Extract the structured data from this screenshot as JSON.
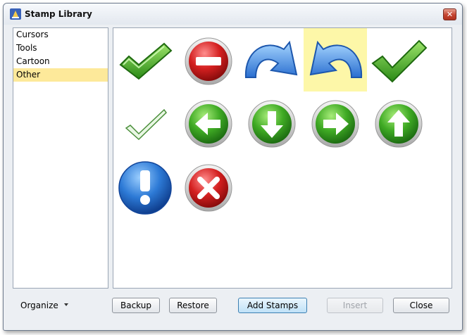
{
  "window": {
    "title": "Stamp Library"
  },
  "categories": [
    {
      "label": "Cursors",
      "selected": false
    },
    {
      "label": "Tools",
      "selected": false
    },
    {
      "label": "Cartoon",
      "selected": false
    },
    {
      "label": "Other",
      "selected": true
    }
  ],
  "stamps": [
    {
      "name": "green-check-3d-icon"
    },
    {
      "name": "red-minus-icon"
    },
    {
      "name": "blue-arrow-redo-icon"
    },
    {
      "name": "blue-arrow-undo-icon",
      "selected": true
    },
    {
      "name": "green-checkmark-icon"
    },
    {
      "name": "outline-checkmark-icon"
    },
    {
      "name": "green-arrow-left-icon"
    },
    {
      "name": "green-arrow-down-icon"
    },
    {
      "name": "green-arrow-right-icon"
    },
    {
      "name": "green-arrow-up-icon"
    },
    {
      "name": "blue-exclamation-icon"
    },
    {
      "name": "red-x-icon"
    }
  ],
  "footer": {
    "organize_label": "Organize",
    "backup_label": "Backup",
    "restore_label": "Restore",
    "add_stamps_label": "Add Stamps",
    "insert_label": "Insert",
    "close_label": "Close"
  },
  "colors": {
    "selection": "#fde99a",
    "stamp_highlight": "#fdf7a8",
    "green": "#3fae2a",
    "red": "#d42a2a",
    "blue": "#2f7fd8"
  }
}
